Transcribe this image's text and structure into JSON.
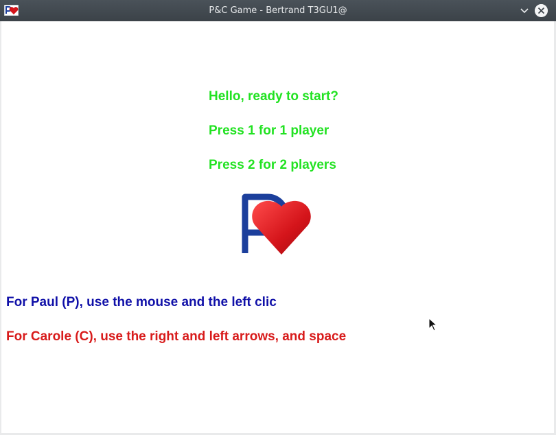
{
  "window": {
    "title": "P&C Game - Bertrand T3GU1@"
  },
  "intro": {
    "greeting": "Hello, ready to start?",
    "option_one": "Press 1 for 1 player",
    "option_two": "Press 2 for 2 players"
  },
  "instructions": {
    "paul": "For Paul (P), use the mouse and the left clic",
    "carole": "For Carole (C), use the right and left arrows, and space"
  },
  "colors": {
    "intro_text": "#22e222",
    "paul_text": "#1010a8",
    "carole_text": "#d81b1b",
    "logo_p": "#1c3f9c",
    "logo_heart": "#d4141a"
  },
  "icons": {
    "app": "pc-heart-icon",
    "minimize": "chevron-down-icon",
    "close": "close-icon",
    "logo": "p-heart-logo",
    "cursor": "mouse-pointer-icon"
  }
}
